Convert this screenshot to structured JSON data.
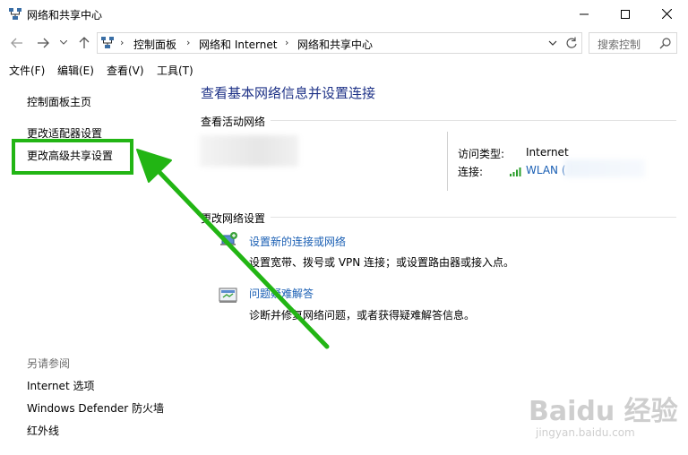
{
  "window": {
    "title": "网络和共享中心",
    "controls": {
      "minimize": "—",
      "maximize": "☐",
      "close": "✕"
    }
  },
  "address": {
    "breadcrumbs": [
      "控制面板",
      "网络和 Internet",
      "网络和共享中心"
    ],
    "search_placeholder": "搜索控制"
  },
  "menu": [
    "文件(F)",
    "编辑(E)",
    "查看(V)",
    "工具(T)"
  ],
  "sidebar": {
    "links": [
      "控制面板主页",
      "更改适配器设置",
      "更改高级共享设置"
    ],
    "see_also_label": "另请参阅",
    "see_also": [
      "Internet 选项",
      "Windows Defender 防火墙",
      "红外线"
    ]
  },
  "main": {
    "heading": "查看基本网络信息并设置连接",
    "active_networks_label": "查看活动网络",
    "access_type_label": "访问类型:",
    "access_type_value": "Internet",
    "connection_label": "连接:",
    "connection_value": "WLAN (",
    "change_settings_label": "更改网络设置",
    "tasks": [
      {
        "title": "设置新的连接或网络",
        "desc": "设置宽带、拨号或 VPN 连接；或设置路由器或接入点。"
      },
      {
        "title": "问题疑难解答",
        "desc": "诊断并修复网络问题，或者获得疑难解答信息。"
      }
    ]
  },
  "colors": {
    "accent_link": "#1a5fb4",
    "heading": "#1e3287",
    "annotation": "#22b514"
  },
  "watermark": {
    "brand": "Baidu 经验",
    "site": "jingyan.baidu.com"
  }
}
